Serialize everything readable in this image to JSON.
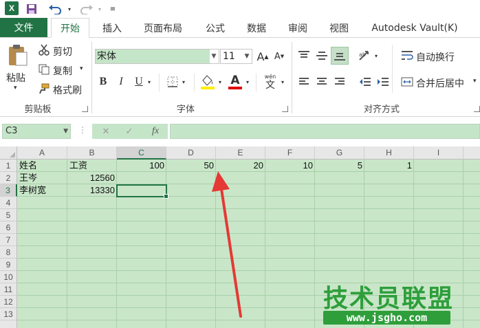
{
  "app": {
    "logo": "X"
  },
  "quick_access": {
    "save_icon": "save-icon",
    "undo_icon": "undo-icon",
    "redo_icon": "redo-icon"
  },
  "tabs": [
    {
      "label": "文件"
    },
    {
      "label": "开始"
    },
    {
      "label": "插入"
    },
    {
      "label": "页面布局"
    },
    {
      "label": "公式"
    },
    {
      "label": "数据"
    },
    {
      "label": "审阅"
    },
    {
      "label": "视图"
    },
    {
      "label": "Autodesk Vault(K)"
    }
  ],
  "ribbon": {
    "clipboard": {
      "paste": "粘贴",
      "cut": "剪切",
      "copy": "复制",
      "format_painter": "格式刷",
      "group_label": "剪贴板"
    },
    "font": {
      "name": "宋体",
      "size": "11",
      "bold": "B",
      "italic": "I",
      "underline": "U",
      "grow": "A",
      "shrink": "A",
      "font_color": "A",
      "phonetic": "wén",
      "phonetic_char": "文",
      "group_label": "字体"
    },
    "alignment": {
      "wrap_text": "自动换行",
      "merge_center": "合并后居中",
      "group_label": "对齐方式"
    }
  },
  "formula_bar": {
    "name_box": "C3",
    "fx": "fx",
    "cancel": "✕",
    "enter": "✓"
  },
  "sheet": {
    "columns": [
      "A",
      "B",
      "C",
      "D",
      "E",
      "F",
      "G",
      "H",
      "I"
    ],
    "rows": [
      "1",
      "2",
      "3",
      "4",
      "5",
      "6",
      "7",
      "8",
      "9",
      "10",
      "11",
      "12",
      "13"
    ],
    "cells": {
      "A1": "姓名",
      "B1": "工资",
      "C1": "100",
      "D1": "50",
      "E1": "20",
      "F1": "10",
      "G1": "5",
      "H1": "1",
      "A2": "王岑",
      "B2": "12560",
      "A3": "李树宽",
      "B3": "13330"
    },
    "selected_cell": "C3"
  },
  "watermark": {
    "title": "技术员联盟",
    "url": "www.jsgho.com"
  },
  "colors": {
    "accent": "#217346",
    "cell_bg": "#c9e6c9",
    "arrow": "#e53935"
  }
}
